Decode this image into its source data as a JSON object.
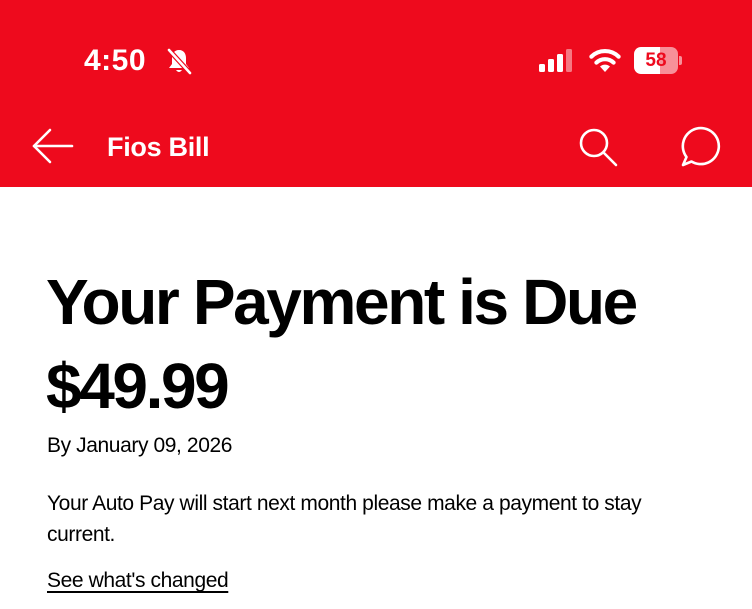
{
  "status_bar": {
    "time": "4:50",
    "battery_level": "58",
    "battery_fraction": 0.58,
    "icons": [
      "bell-slash-icon",
      "cellular-signal-icon",
      "wifi-icon",
      "battery-icon"
    ]
  },
  "header": {
    "title": "Fios Bill",
    "icons": [
      "back-arrow-icon",
      "search-icon",
      "chat-bubble-icon"
    ]
  },
  "bill": {
    "heading": "Your Payment is Due",
    "amount": "$49.99",
    "due_date": "By January 09, 2026",
    "message": "Your Auto Pay will start next month please make a payment to stay current.",
    "link_label": "See what's changed"
  },
  "colors": {
    "brand_red": "#ee0a1d",
    "text": "#000000",
    "background": "#ffffff"
  }
}
